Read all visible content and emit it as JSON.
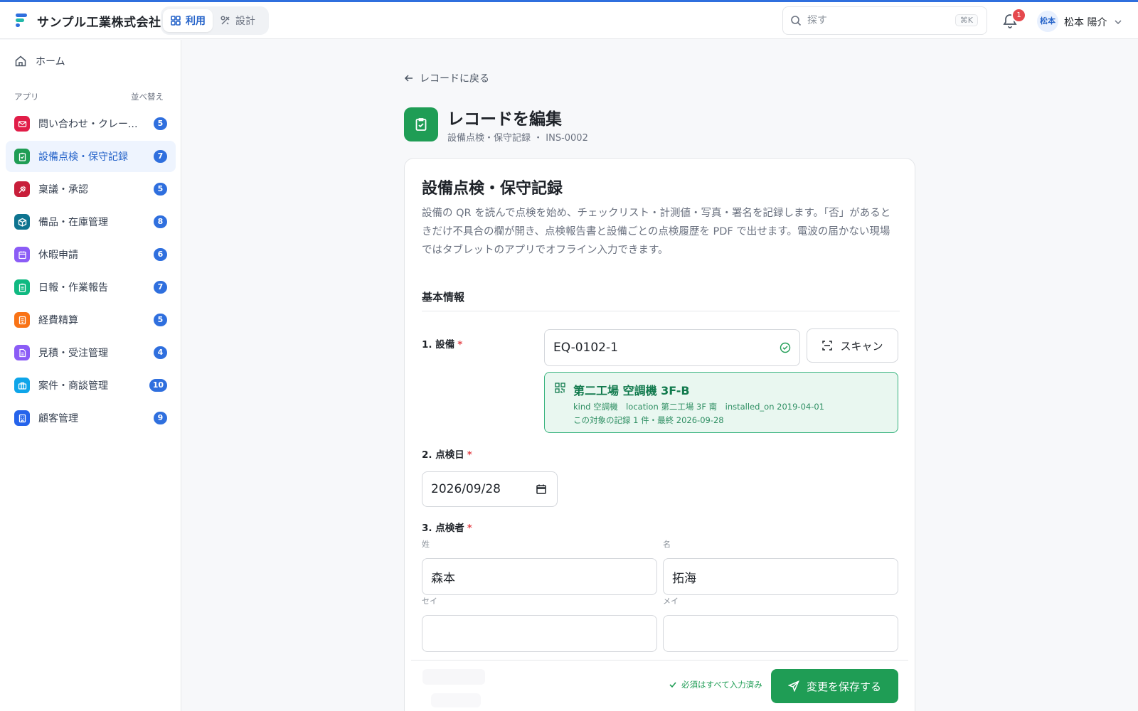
{
  "header": {
    "company": "サンプル工業株式会社",
    "modes": [
      {
        "label": "利用",
        "icon": "grid-icon",
        "active": true
      },
      {
        "label": "設計",
        "icon": "tools-icon",
        "active": false
      }
    ],
    "search_placeholder": "探す",
    "search_shortcut": "⌘K",
    "notification_count": "1",
    "avatar_text": "松本",
    "user_name": "松本 陽介"
  },
  "sidebar": {
    "home_label": "ホーム",
    "section_label": "アプリ",
    "sort_label": "並べ替え",
    "apps": [
      {
        "label": "問い合わせ・クレーム管理",
        "count": "5",
        "color": "#e11d48",
        "icon": "mail-icon",
        "active": false
      },
      {
        "label": "設備点検・保守記録",
        "count": "7",
        "color": "#1f9d55",
        "icon": "clipboard-check-icon",
        "active": true
      },
      {
        "label": "稟議・承認",
        "count": "5",
        "color": "#c81e3a",
        "icon": "stamp-icon",
        "active": false
      },
      {
        "label": "備品・在庫管理",
        "count": "8",
        "color": "#0e7490",
        "icon": "box-icon",
        "active": false
      },
      {
        "label": "休暇申請",
        "count": "6",
        "color": "#8b5cf6",
        "icon": "calendar-icon",
        "active": false
      },
      {
        "label": "日報・作業報告",
        "count": "7",
        "color": "#10b981",
        "icon": "clipboard-icon",
        "active": false
      },
      {
        "label": "経費精算",
        "count": "5",
        "color": "#f97316",
        "icon": "receipt-icon",
        "active": false
      },
      {
        "label": "見積・受注管理",
        "count": "4",
        "color": "#8b5cf6",
        "icon": "document-icon",
        "active": false
      },
      {
        "label": "案件・商談管理",
        "count": "10",
        "color": "#0ea5e9",
        "icon": "briefcase-icon",
        "active": false
      },
      {
        "label": "顧客管理",
        "count": "9",
        "color": "#2563eb",
        "icon": "building-icon",
        "active": false
      }
    ]
  },
  "main": {
    "back_label": "レコードに戻る",
    "page_title": "レコードを編集",
    "page_subtitle": "設備点検・保守記録 ・ INS-0002",
    "form_title": "設備点検・保守記録",
    "form_description": "設備の QR を読んで点検を始め、チェックリスト・計測値・写真・署名を記録します。「否」があるときだけ不具合の欄が開き、点検報告書と設備ごとの点検履歴を PDF で出せます。電波の届かない現場ではタブレットのアプリでオフライン入力できます。",
    "section_title": "基本情報",
    "fields": {
      "equipment": {
        "label": "1. 設備",
        "value": "EQ-0102-1",
        "scan_label": "スキャン",
        "match": {
          "name": "第二工場 空調機 3F-B",
          "meta": "kind 空調機　location 第二工場 3F 南　installed_on 2019-04-01",
          "history": "この対象の記録 1 件・最終 2026-09-28"
        }
      },
      "date": {
        "label": "2. 点検日",
        "value": "2026/09/28"
      },
      "inspector": {
        "label": "3. 点検者",
        "last_name_label": "姓",
        "last_name": "森本",
        "first_name_label": "名",
        "first_name": "拓海",
        "last_kana_label": "セイ",
        "last_kana": "",
        "first_kana_label": "メイ",
        "first_kana": ""
      }
    },
    "footer": {
      "status": "必須はすべて入力済み",
      "save_label": "変更を保存する"
    }
  },
  "colors": {
    "accent": "#2f6fde",
    "success": "#1f9d55",
    "required": "#e5484d"
  }
}
